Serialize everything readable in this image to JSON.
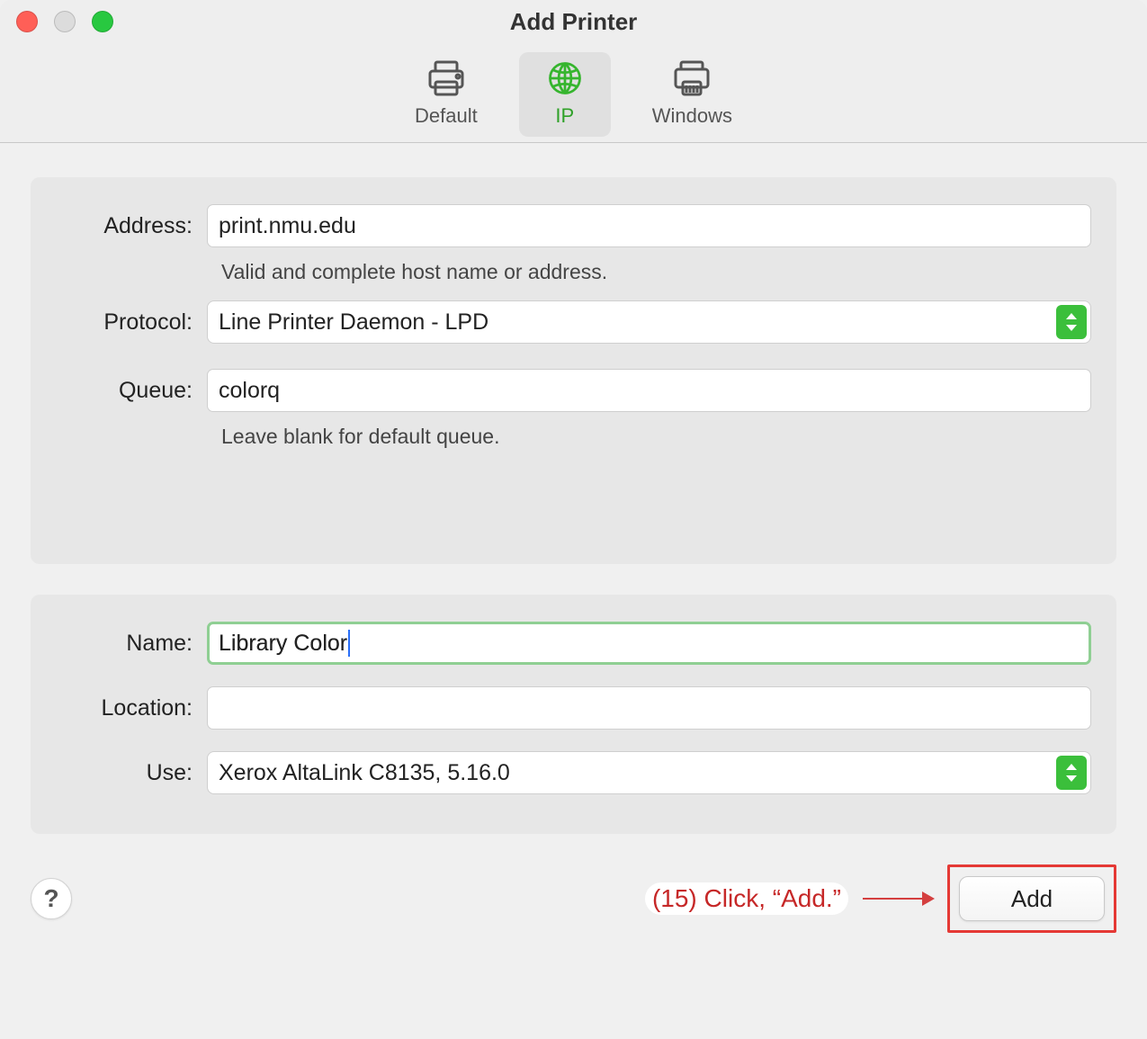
{
  "window": {
    "title": "Add Printer"
  },
  "tabs": {
    "default": "Default",
    "ip": "IP",
    "windows": "Windows",
    "selected": "ip"
  },
  "form": {
    "address": {
      "label": "Address:",
      "value": "print.nmu.edu",
      "helper": "Valid and complete host name or address."
    },
    "protocol": {
      "label": "Protocol:",
      "value": "Line Printer Daemon - LPD"
    },
    "queue": {
      "label": "Queue:",
      "value": "colorq",
      "helper": "Leave blank for default queue."
    },
    "name": {
      "label": "Name:",
      "value": "Library Color"
    },
    "location": {
      "label": "Location:",
      "value": ""
    },
    "use": {
      "label": "Use:",
      "value": "Xerox AltaLink C8135, 5.16.0"
    }
  },
  "buttons": {
    "help": "?",
    "add": "Add"
  },
  "annotation": {
    "text": "(15) Click, “Add.”"
  }
}
